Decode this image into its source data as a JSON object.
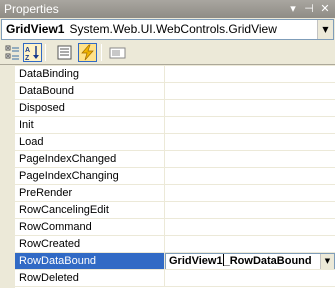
{
  "window": {
    "title": "Properties",
    "pin_glyph": "▾",
    "autohide_glyph": "⊣",
    "close_glyph": "✕"
  },
  "object_selector": {
    "name": "GridView1",
    "type": "System.Web.UI.WebControls.GridView",
    "dropdown_glyph": "▼"
  },
  "toolbar": {
    "buttons": [
      {
        "icon": "categorized-icon",
        "pressed": false
      },
      {
        "icon": "alphabetical-icon",
        "pressed": true
      },
      {
        "icon": "properties-icon",
        "pressed": false
      },
      {
        "icon": "events-icon",
        "pressed": true
      },
      {
        "icon": "property-pages-icon",
        "pressed": false
      }
    ]
  },
  "events": [
    {
      "name": "DataBinding",
      "value": ""
    },
    {
      "name": "DataBound",
      "value": ""
    },
    {
      "name": "Disposed",
      "value": ""
    },
    {
      "name": "Init",
      "value": ""
    },
    {
      "name": "Load",
      "value": ""
    },
    {
      "name": "PageIndexChanged",
      "value": ""
    },
    {
      "name": "PageIndexChanging",
      "value": ""
    },
    {
      "name": "PreRender",
      "value": ""
    },
    {
      "name": "RowCancelingEdit",
      "value": ""
    },
    {
      "name": "RowCommand",
      "value": ""
    },
    {
      "name": "RowCreated",
      "value": ""
    },
    {
      "name": "RowDataBound",
      "value": "",
      "selected": true
    },
    {
      "name": "RowDeleted",
      "value": ""
    }
  ],
  "editor": {
    "value_before_caret": "GridView1",
    "value_after_caret": "_RowDataBound",
    "dropdown_glyph": "▼"
  },
  "colors": {
    "selection": "#316ac5",
    "background": "#ece9d8"
  }
}
